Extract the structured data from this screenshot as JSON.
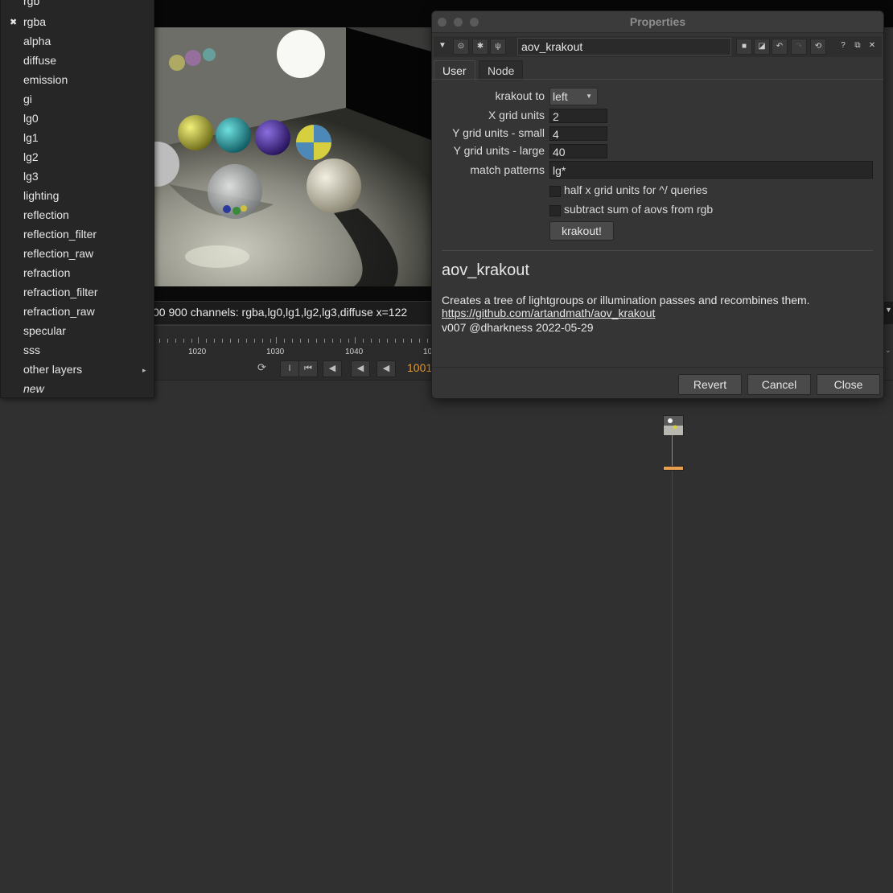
{
  "viewer": {
    "info_text": "00 900 channels: rgba,lg0,lg1,lg2,lg3,diffuse  x=122",
    "timeline_labels": [
      "1020",
      "1030",
      "1040",
      "10"
    ],
    "frame": "1001"
  },
  "channel_menu": {
    "items": [
      {
        "label": "rgb",
        "checked": false
      },
      {
        "label": "rgba",
        "checked": true
      },
      {
        "label": "alpha",
        "checked": false
      },
      {
        "label": "diffuse",
        "checked": false
      },
      {
        "label": "emission",
        "checked": false
      },
      {
        "label": "gi",
        "checked": false
      },
      {
        "label": "lg0",
        "checked": false
      },
      {
        "label": "lg1",
        "checked": false
      },
      {
        "label": "lg2",
        "checked": false
      },
      {
        "label": "lg3",
        "checked": false
      },
      {
        "label": "lighting",
        "checked": false
      },
      {
        "label": "reflection",
        "checked": false
      },
      {
        "label": "reflection_filter",
        "checked": false
      },
      {
        "label": "reflection_raw",
        "checked": false
      },
      {
        "label": "refraction",
        "checked": false
      },
      {
        "label": "refraction_filter",
        "checked": false
      },
      {
        "label": "refraction_raw",
        "checked": false
      },
      {
        "label": "specular",
        "checked": false
      },
      {
        "label": "sss",
        "checked": false
      },
      {
        "label": "other layers",
        "checked": false,
        "submenu": true
      },
      {
        "label": "new",
        "checked": false,
        "italic": true
      }
    ],
    "check_glyph": "✖",
    "submenu_glyph": "▸"
  },
  "properties": {
    "window_title": "Properties",
    "node_name": "aov_krakout",
    "tabs": [
      "User",
      "Node"
    ],
    "knobs": {
      "krakout_to_label": "krakout to",
      "krakout_to_value": "left",
      "x_grid_label": "X grid units",
      "x_grid_value": "2",
      "y_small_label": "Y grid units - small",
      "y_small_value": "4",
      "y_large_label": "Y grid units - large",
      "y_large_value": "40",
      "match_label": "match patterns",
      "match_value": "lg*",
      "half_x_label": "half x grid units for ^/ queries",
      "half_x_checked": false,
      "subtract_label": "subtract sum of aovs from rgb",
      "subtract_checked": false,
      "krakout_button": "krakout!"
    },
    "help": {
      "title": "aov_krakout",
      "description": "Creates a tree of lightgroups or illumination passes and recombines them.",
      "link": "https://github.com/artandmath/aov_krakout",
      "version": "v007 @dharkness 2022-05-29"
    },
    "buttons": {
      "revert": "Revert",
      "cancel": "Cancel",
      "close": "Close"
    }
  },
  "colors": {
    "frame_accent": "#e89a2c",
    "node_dot": "#e8a050",
    "panel_bg": "#353535",
    "graph_bg": "#303030"
  }
}
